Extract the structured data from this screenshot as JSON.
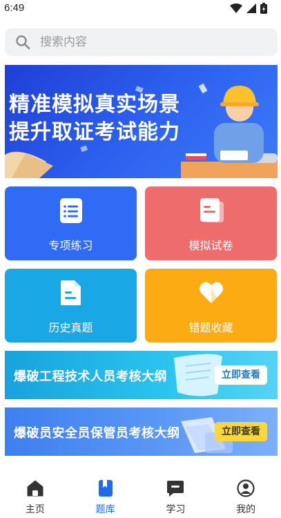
{
  "status_bar": {
    "time": "6:49"
  },
  "search": {
    "placeholder": "搜索内容",
    "value": ""
  },
  "banner": {
    "line1": "精准模拟真实场景",
    "line2": "提升取证考试能力"
  },
  "cards": [
    {
      "label": "专项练习",
      "color": "#2f6bf5",
      "icon": "list-doc-icon"
    },
    {
      "label": "模拟试卷",
      "color": "#ef6c6c",
      "icon": "exam-paper-icon"
    },
    {
      "label": "历史真题",
      "color": "#1aa7e6",
      "icon": "document-icon"
    },
    {
      "label": "错题收藏",
      "color": "#fdab12",
      "icon": "heart-icon"
    }
  ],
  "promos": [
    {
      "title": "爆破工程技术人员考核大纲",
      "button": "立即查看"
    },
    {
      "title": "爆破员安全员保管员考核大纲",
      "button": "立即查看"
    }
  ],
  "nav": {
    "active_color": "#1c6bf0",
    "items": [
      {
        "label": "主页",
        "icon": "home-icon"
      },
      {
        "label": "题库",
        "icon": "bookmark-book-icon",
        "active": true
      },
      {
        "label": "学习",
        "icon": "chat-icon"
      },
      {
        "label": "我的",
        "icon": "profile-icon"
      }
    ]
  }
}
